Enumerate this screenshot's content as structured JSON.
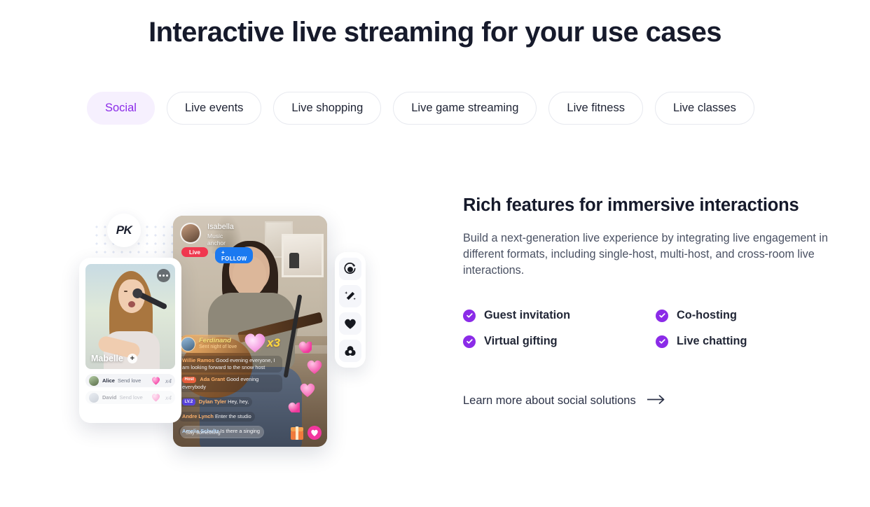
{
  "page": {
    "title": "Interactive live streaming for your use cases"
  },
  "tabs": [
    {
      "label": "Social",
      "active": true
    },
    {
      "label": "Live events",
      "active": false
    },
    {
      "label": "Live shopping",
      "active": false
    },
    {
      "label": "Live game streaming",
      "active": false
    },
    {
      "label": "Live fitness",
      "active": false
    },
    {
      "label": "Live classes",
      "active": false
    }
  ],
  "content": {
    "heading": "Rich features for immersive interactions",
    "description": "Build a next-generation live experience by integrating live engagement in different formats, including single-host, multi-host, and cross-room live interactions.",
    "features": [
      "Guest invitation",
      "Co-hosting",
      "Virtual gifting",
      "Live chatting"
    ],
    "link": {
      "label": "Learn more about social solutions",
      "icon": "arrow-right-icon"
    }
  },
  "illustration": {
    "pk_badge": "PK",
    "main_stream": {
      "host_name": "Isabella",
      "host_role": "Music anchor",
      "live_badge": "Live",
      "follow_button": "+ FOLLOW",
      "gift_banner": {
        "sender": "Ferdinand",
        "action": "Sent night of love",
        "multiplier": "x3",
        "icon": "heart-gift-icon"
      },
      "chat": [
        {
          "user": "Willie Ramos",
          "badge": "",
          "message": "Good evening everyone, I am looking forward to the  snow host",
          "color": "orange"
        },
        {
          "user": "Ada Grant",
          "badge": "Host",
          "message": "Good evening everybody",
          "color": "orange"
        },
        {
          "user": "Dylan Tyler",
          "badge": "LV.2",
          "message": "Hey, hey,",
          "color": "orange"
        },
        {
          "user": "Andre Lynch",
          "badge": "",
          "message": "Enter the studio",
          "color": "orange"
        },
        {
          "user": "Amelia Schultz",
          "badge": "",
          "message": "Is there a singing",
          "color": "blue"
        }
      ],
      "input_placeholder": "Say something",
      "bottom_icons": [
        "gift-icon",
        "heart-icon"
      ]
    },
    "guest_card": {
      "name": "Mabelle",
      "add_icon": "plus-icon",
      "more_icon": "more-options-icon",
      "gifts": [
        {
          "user": "Alice",
          "action": "Send love",
          "count": "x4"
        },
        {
          "user": "David",
          "action": "Send love",
          "count": "x4"
        }
      ]
    },
    "tool_rail": [
      "beauty-filter-icon",
      "magic-wand-icon",
      "heart-icon",
      "color-filter-icon"
    ]
  },
  "colors": {
    "accent_purple": "#8b2be8",
    "accent_purple_soft": "#f6f0fe",
    "text_dark": "#161a2b",
    "text_body": "#4a5163",
    "border": "#e7e9ef"
  }
}
